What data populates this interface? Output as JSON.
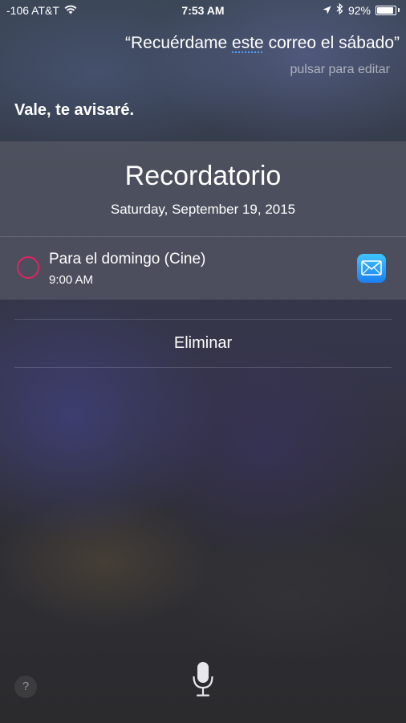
{
  "status_bar": {
    "signal": "-106 AT&T",
    "time": "7:53 AM",
    "battery_percent": "92%",
    "battery_level": 0.92,
    "icons": [
      "wifi-icon",
      "location-arrow-icon",
      "bluetooth-icon",
      "battery-icon"
    ]
  },
  "siri": {
    "utterance_open_quote": "“",
    "utterance_before": "Recuérdame ",
    "utterance_underlined": "este",
    "utterance_after": " correo el sábado”",
    "tap_to_edit": "pulsar para editar",
    "response": "Vale, te avisaré."
  },
  "reminder_card": {
    "title": "Recordatorio",
    "date": "Saturday, September 19, 2015",
    "item": {
      "title": "Para el domingo (Cine)",
      "time": "9:00 AM",
      "icon": "mail-app-icon"
    }
  },
  "actions": {
    "delete_label": "Eliminar"
  },
  "bottom": {
    "help_label": "?",
    "mic_icon": "microphone-icon"
  },
  "colors": {
    "reminder_circle": "#e0245e",
    "edit_underline": "#4aa3ff",
    "mail_icon_top": "#3ec4ff",
    "mail_icon_bottom": "#1b7ff0"
  }
}
